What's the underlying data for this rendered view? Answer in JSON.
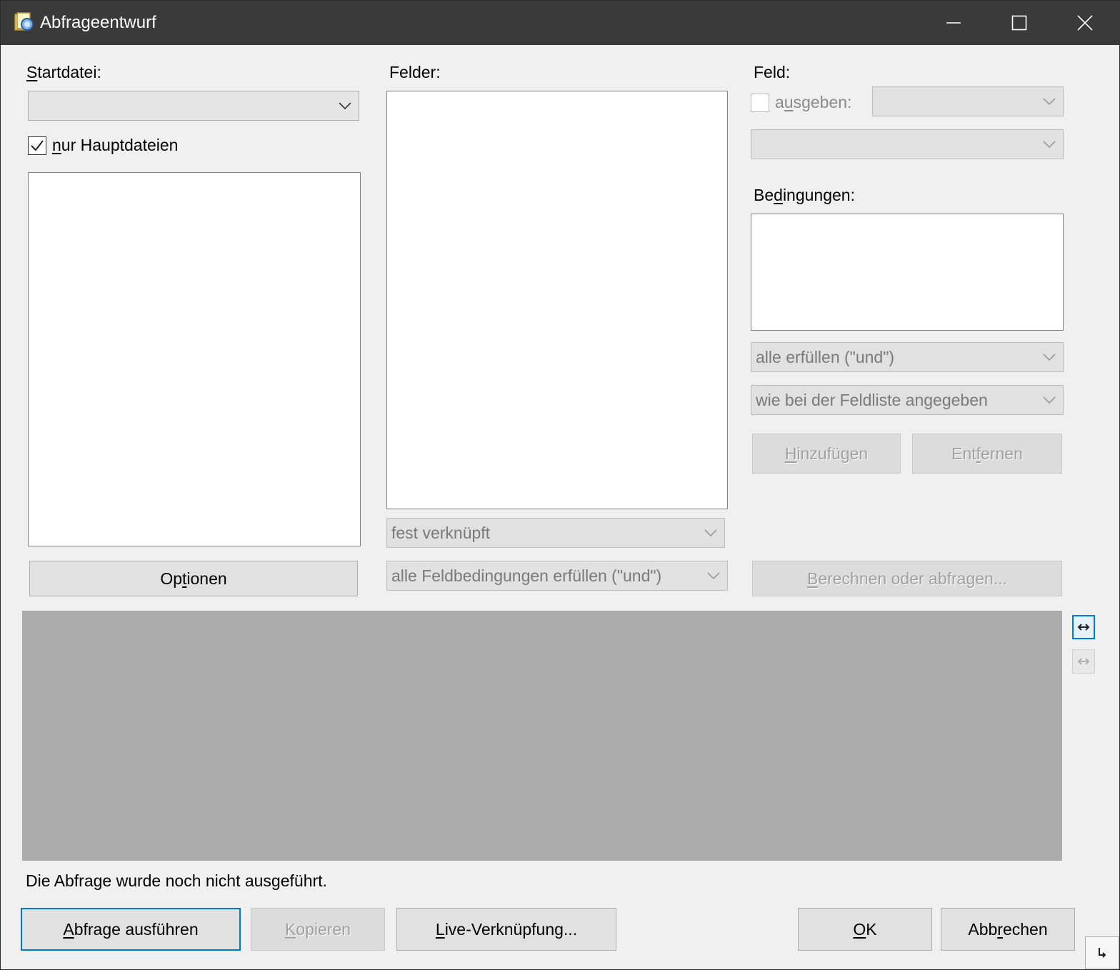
{
  "window": {
    "title": "Abfrageentwurf"
  },
  "left": {
    "startdatei_label": "Startdatei:",
    "startdatei_mnemonic": "S",
    "startdatei_rest": "tartdatei:",
    "startdatei_value": "",
    "checkbox_checked": true,
    "checkbox_mnemonic": "n",
    "checkbox_rest": "ur Hauptdateien",
    "optionen_pre": "Op",
    "optionen_mnemonic": "t",
    "optionen_post": "ionen"
  },
  "middle": {
    "felder_label": "Felder:",
    "link_type": "fest verknüpft",
    "field_condition_mode": "alle Feldbedingungen erfüllen (\"und\")"
  },
  "right": {
    "feld_label": "Feld:",
    "ausgeben_pre": "a",
    "ausgeben_mnemonic": "u",
    "ausgeben_post": "sgeben:",
    "ausgeben_checked": false,
    "ausgeben_value": "",
    "feld_value": "",
    "bedingungen_pre": "Be",
    "bedingungen_mnemonic": "d",
    "bedingungen_post": "ingungen:",
    "conditions_mode": "alle erfüllen (\"und\")",
    "conditions_scope": "wie bei der Feldliste angegeben",
    "add_mnemonic": "H",
    "add_rest": "inzufügen",
    "remove_pre": "Ent",
    "remove_mnemonic": "f",
    "remove_post": "ernen",
    "calc_mnemonic": "B",
    "calc_rest": "erechnen oder abfragen..."
  },
  "status": {
    "text": "Die Abfrage wurde noch nicht ausgeführt."
  },
  "footer": {
    "run_mnemonic": "A",
    "run_rest": "bfrage ausführen",
    "copy_mnemonic": "K",
    "copy_rest": "opieren",
    "live_mnemonic": "L",
    "live_rest": "ive-Verknüpfung...",
    "ok_mnemonic": "O",
    "ok_rest": "K",
    "cancel_pre": "Abb",
    "cancel_mnemonic": "r",
    "cancel_post": "echen"
  },
  "icons": {
    "app": "query-app-icon",
    "minimize": "minimize-icon",
    "maximize": "maximize-icon",
    "close": "close-icon",
    "dropdown": "chevron-down-icon",
    "check": "checkmark-icon",
    "side_active": "horizontal-layout-icon",
    "side_disabled": "vertical-layout-icon",
    "corner": "resize-corner-icon"
  },
  "colors": {
    "titlebar": "#3a3a3a",
    "accent": "#0078d7",
    "grid_area": "#ababab",
    "dialog_bg": "#f0f0f0"
  }
}
